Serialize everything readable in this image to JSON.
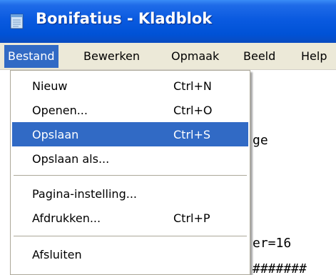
{
  "window": {
    "title": "Bonifatius - Kladblok",
    "icon": "notepad-icon"
  },
  "menubar": {
    "items": [
      {
        "label": "Bestand",
        "active": true
      },
      {
        "label": "Bewerken"
      },
      {
        "label": "Opmaak"
      },
      {
        "label": "Beeld"
      },
      {
        "label": "Help"
      }
    ]
  },
  "file_menu": {
    "items": [
      {
        "label": "Nieuw",
        "shortcut": "Ctrl+N"
      },
      {
        "label": "Openen...",
        "shortcut": "Ctrl+O"
      },
      {
        "label": "Opslaan",
        "shortcut": "Ctrl+S",
        "highlighted": true
      },
      {
        "label": "Opslaan als...",
        "shortcut": ""
      },
      {
        "label": "Pagina-instelling...",
        "shortcut": ""
      },
      {
        "label": "Afdrukken...",
        "shortcut": "Ctrl+P"
      },
      {
        "label": "Afsluiten",
        "shortcut": ""
      }
    ]
  },
  "editor": {
    "visible_fragments": [
      "ge",
      "er=16",
      "#######"
    ]
  },
  "colors": {
    "titlebar": "#0052d6",
    "menubar": "#ece9d8",
    "highlight": "#316ac5"
  }
}
